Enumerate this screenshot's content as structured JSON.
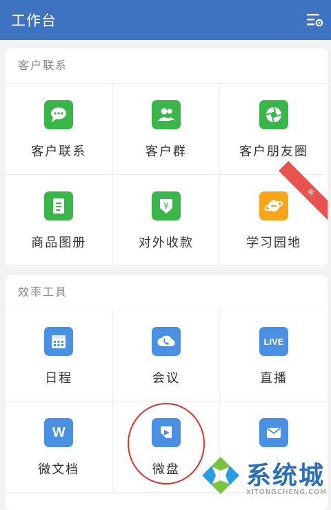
{
  "header": {
    "title": "工作台",
    "settings_icon": "list-settings-icon"
  },
  "sections": [
    {
      "title": "客户联系",
      "items": [
        {
          "label": "客户联系",
          "icon": "chat-bubble-icon",
          "color": "#39b54a"
        },
        {
          "label": "客户群",
          "icon": "group-people-icon",
          "color": "#39b54a"
        },
        {
          "label": "客户朋友圈",
          "icon": "aperture-icon",
          "color": "#39b54a"
        },
        {
          "label": "商品图册",
          "icon": "catalog-icon",
          "color": "#39b54a"
        },
        {
          "label": "对外收款",
          "icon": "yuan-shield-icon",
          "color": "#39b54a"
        },
        {
          "label": "学习园地",
          "icon": "planet-icon",
          "color": "#f7a519",
          "badge": "新"
        }
      ]
    },
    {
      "title": "效率工具",
      "items": [
        {
          "label": "日程",
          "icon": "calendar-icon",
          "color": "#4a90e2"
        },
        {
          "label": "会议",
          "icon": "cloud-phone-icon",
          "color": "#4a90e2"
        },
        {
          "label": "直播",
          "icon": "live-icon",
          "color": "#4a90e2",
          "icon_text": "LIVE"
        },
        {
          "label": "微文档",
          "icon": "doc-w-icon",
          "color": "#4a90e2",
          "icon_text": "W"
        },
        {
          "label": "微盘",
          "icon": "drive-icon",
          "color": "#4a90e2"
        },
        {
          "label": "邮件",
          "icon": "mail-icon",
          "color": "#4a90e2"
        }
      ]
    }
  ],
  "watermark": {
    "text": "系统城",
    "subtext": "XITONGCHENG.COM"
  }
}
